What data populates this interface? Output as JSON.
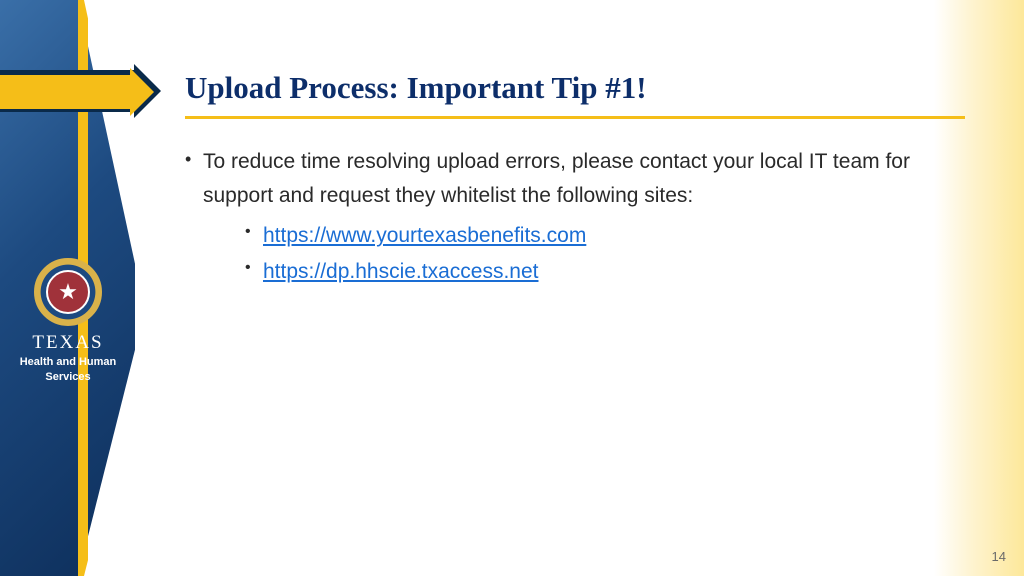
{
  "title": "Upload Process: Important Tip #1!",
  "bullet_main": "To reduce time resolving upload errors, please contact your local IT team for support and request they whitelist the following sites:",
  "links": {
    "a": "https://www.yourtexasbenefits.com",
    "b": "https://dp.hhscie.txaccess.net"
  },
  "logo": {
    "state": "TEXAS",
    "agency_line1": "Health and Human",
    "agency_line2": "Services"
  },
  "page_number": "14"
}
